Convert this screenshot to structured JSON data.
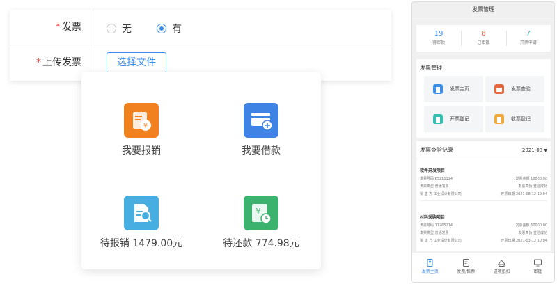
{
  "form": {
    "invoice_label": "发票",
    "radio_no": "无",
    "radio_yes": "有",
    "upload_label": "上传发票",
    "choose_file": "选择文件",
    "required_mark": "*"
  },
  "popup": {
    "tiles": [
      {
        "label": "我要报销",
        "icon": "reimburse-icon",
        "color": "#f0811e"
      },
      {
        "label": "我要借款",
        "icon": "loan-card-icon",
        "color": "#3f84e5"
      },
      {
        "label": "待报销 1479.00元",
        "icon": "pending-doc-icon",
        "color": "#46aee0"
      },
      {
        "label": "待还款 774.98元",
        "icon": "repay-clock-icon",
        "color": "#3bb36f"
      }
    ]
  },
  "phone": {
    "title": "发票管理",
    "stats": [
      {
        "value": "19",
        "label": "待审批",
        "color": "#3b8eea"
      },
      {
        "value": "8",
        "label": "已审批",
        "color": "#e56a4a"
      },
      {
        "value": "7",
        "label": "开票申请",
        "color": "#2bb3a5"
      }
    ],
    "mgmt_title": "发票管理",
    "mgmt_items": [
      {
        "label": "发票主页",
        "icon": "invoice-home-icon",
        "color": "#3b8eea"
      },
      {
        "label": "发票查验",
        "icon": "invoice-check-icon",
        "color": "#e5693f"
      },
      {
        "label": "开票登记",
        "icon": "issue-register-icon",
        "color": "#33c0b0"
      },
      {
        "label": "收票登记",
        "icon": "receive-register-icon",
        "color": "#f2a93b"
      }
    ],
    "records_title": "发票查验记录",
    "month": "2021-08",
    "records": [
      {
        "name": "软件开发项目",
        "no_label": "发票号码",
        "no": "65211124",
        "amount_label": "发票金额",
        "amount": "10000.00",
        "type_label": "发票类型",
        "type": "普通发票",
        "truth_label": "发票真伪",
        "truth": "查验成功",
        "seller_label": "销 售 方",
        "seller": "工业设计有限公司",
        "date_label": "开票日期",
        "date": "2021-08-12 10:04"
      },
      {
        "name": "材料采购项目",
        "no_label": "发票号码",
        "no": "11265214",
        "amount_label": "发票金额",
        "amount": "50000.00",
        "type_label": "发票类型",
        "type": "普通发票",
        "truth_label": "发票真伪",
        "truth": "查验成功",
        "seller_label": "销 售 方",
        "seller": "工业设计有限公司",
        "date_label": "开票日期",
        "date": "2021-03-12 10:04"
      }
    ],
    "tabs": [
      {
        "label": "发票主页",
        "icon": "home-doc-icon"
      },
      {
        "label": "发票/售票",
        "icon": "ticket-icon"
      },
      {
        "label": "进项抵扣",
        "icon": "deduct-icon"
      },
      {
        "label": "审批",
        "icon": "approve-icon"
      }
    ]
  }
}
